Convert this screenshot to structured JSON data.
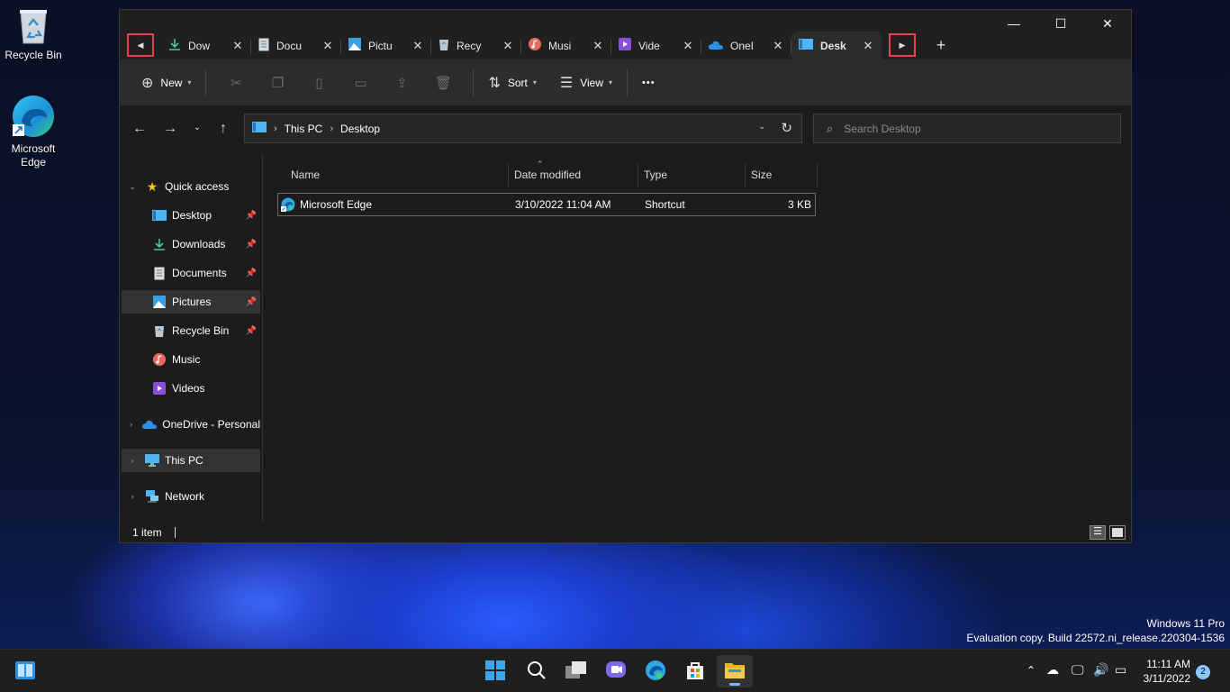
{
  "desktop": {
    "icons": [
      {
        "label": "Recycle Bin",
        "icon": "recycle-bin-icon"
      },
      {
        "label": "Microsoft Edge",
        "icon": "edge-icon"
      }
    ],
    "watermark": {
      "line1": "Windows 11 Pro",
      "line2": "Evaluation copy. Build 22572.ni_release.220304-1536"
    }
  },
  "window": {
    "tabs": [
      {
        "label": "Dow",
        "icon": "downloads-icon"
      },
      {
        "label": "Docu",
        "icon": "documents-icon"
      },
      {
        "label": "Pictu",
        "icon": "pictures-icon"
      },
      {
        "label": "Recy",
        "icon": "recycle-bin-icon"
      },
      {
        "label": "Musi",
        "icon": "music-icon"
      },
      {
        "label": "Vide",
        "icon": "videos-icon"
      },
      {
        "label": "OneI",
        "icon": "onedrive-icon"
      },
      {
        "label": "Desk",
        "icon": "desktop-icon"
      }
    ],
    "active_tab_index": 7,
    "controls": {
      "minimize": "—",
      "maximize": "☐",
      "close": "✕"
    },
    "toolbar": {
      "new_label": "New",
      "sort_label": "Sort",
      "view_label": "View",
      "more_label": "•••"
    },
    "address": {
      "crumbs": [
        "This PC",
        "Desktop"
      ],
      "search_placeholder": "Search Desktop"
    },
    "sidebar": {
      "quick_access_label": "Quick access",
      "items": [
        {
          "label": "Desktop",
          "icon": "desktop-icon",
          "pinned": true
        },
        {
          "label": "Downloads",
          "icon": "downloads-icon",
          "pinned": true
        },
        {
          "label": "Documents",
          "icon": "documents-icon",
          "pinned": true
        },
        {
          "label": "Pictures",
          "icon": "pictures-icon",
          "pinned": true
        },
        {
          "label": "Recycle Bin",
          "icon": "recycle-bin-icon",
          "pinned": true
        },
        {
          "label": "Music",
          "icon": "music-icon",
          "pinned": false
        },
        {
          "label": "Videos",
          "icon": "videos-icon",
          "pinned": false
        }
      ],
      "onedrive_label": "OneDrive - Personal",
      "thispc_label": "This PC",
      "network_label": "Network"
    },
    "columns": {
      "name": "Name",
      "date": "Date modified",
      "type": "Type",
      "size": "Size"
    },
    "files": [
      {
        "name": "Microsoft Edge",
        "date": "3/10/2022 11:04 AM",
        "type": "Shortcut",
        "size": "3 KB"
      }
    ],
    "status": {
      "count": "1 item"
    }
  },
  "taskbar": {
    "apps": [
      "widgets-icon",
      "start-icon",
      "search-icon",
      "task-view-icon",
      "chat-icon",
      "edge-icon",
      "store-icon",
      "file-explorer-icon"
    ],
    "clock_time": "11:11 AM",
    "clock_date": "3/11/2022",
    "notification_count": "2"
  },
  "colors": {
    "accent": "#e0464a",
    "selection": "#333333",
    "background": "#1c1c1c"
  }
}
